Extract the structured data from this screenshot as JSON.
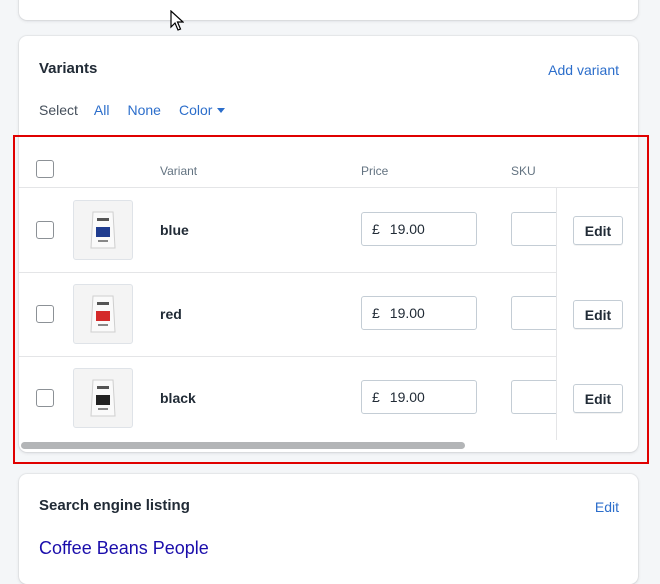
{
  "variants_card": {
    "title": "Variants",
    "add_variant_label": "Add variant",
    "select": {
      "label": "Select",
      "all": "All",
      "none": "None",
      "color": "Color"
    },
    "table": {
      "headers": {
        "variant": "Variant",
        "price": "Price",
        "sku": "SKU"
      },
      "rows": [
        {
          "name": "blue",
          "currency": "£",
          "price": "19.00",
          "edit_label": "Edit",
          "accent": "#1f3c8f"
        },
        {
          "name": "red",
          "currency": "£",
          "price": "19.00",
          "edit_label": "Edit",
          "accent": "#d42a2a"
        },
        {
          "name": "black",
          "currency": "£",
          "price": "19.00",
          "edit_label": "Edit",
          "accent": "#222222"
        }
      ]
    }
  },
  "seo_card": {
    "title": "Search engine listing",
    "edit_label": "Edit",
    "page_title": "Coffee Beans People"
  },
  "colors": {
    "link": "#2c6ecb",
    "highlight": "#e00000",
    "seo_title": "#1a0dab"
  }
}
